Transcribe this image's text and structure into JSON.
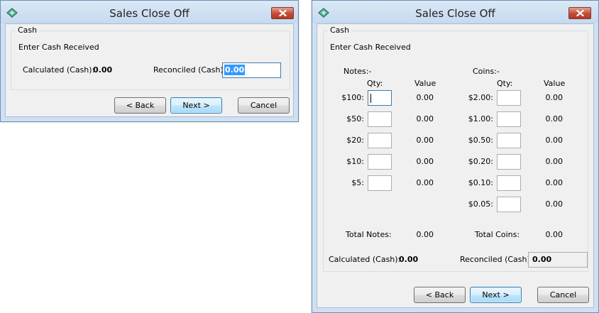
{
  "colors": {
    "title_text": "#222222",
    "selection": "#3399ff",
    "close_button": "#c24a35",
    "client_bg": "#f0f0f0"
  },
  "window1": {
    "title": "Sales Close Off",
    "group_title": "Cash",
    "instruction": "Enter Cash Received",
    "calculated_label": "Calculated (Cash):",
    "calculated_value": "0.00",
    "reconciled_label": "Reconciled (Cash):",
    "reconciled_value": "0.00",
    "buttons": {
      "back": "< Back",
      "next": "Next >",
      "cancel": "Cancel"
    }
  },
  "window2": {
    "title": "Sales Close Off",
    "group_title": "Cash",
    "instruction": "Enter Cash Received",
    "notes": {
      "heading": "Notes:-",
      "qty_header": "Qty:",
      "value_header": "Value",
      "rows": [
        {
          "label": "$100:",
          "qty": "",
          "value": "0.00"
        },
        {
          "label": "$50:",
          "qty": "",
          "value": "0.00"
        },
        {
          "label": "$20:",
          "qty": "",
          "value": "0.00"
        },
        {
          "label": "$10:",
          "qty": "",
          "value": "0.00"
        },
        {
          "label": "$5:",
          "qty": "",
          "value": "0.00"
        }
      ],
      "total_label": "Total Notes:",
      "total_value": "0.00"
    },
    "coins": {
      "heading": "Coins:-",
      "qty_header": "Qty:",
      "value_header": "Value",
      "rows": [
        {
          "label": "$2.00:",
          "qty": "",
          "value": "0.00"
        },
        {
          "label": "$1.00:",
          "qty": "",
          "value": "0.00"
        },
        {
          "label": "$0.50:",
          "qty": "",
          "value": "0.00"
        },
        {
          "label": "$0.20:",
          "qty": "",
          "value": "0.00"
        },
        {
          "label": "$0.10:",
          "qty": "",
          "value": "0.00"
        },
        {
          "label": "$0.05:",
          "qty": "",
          "value": "0.00"
        }
      ],
      "total_label": "Total Coins:",
      "total_value": "0.00"
    },
    "calculated_label": "Calculated (Cash):",
    "calculated_value": "0.00",
    "reconciled_label": "Reconciled (Cash):",
    "reconciled_value": "0.00",
    "buttons": {
      "back": "< Back",
      "next": "Next >",
      "cancel": "Cancel"
    }
  }
}
